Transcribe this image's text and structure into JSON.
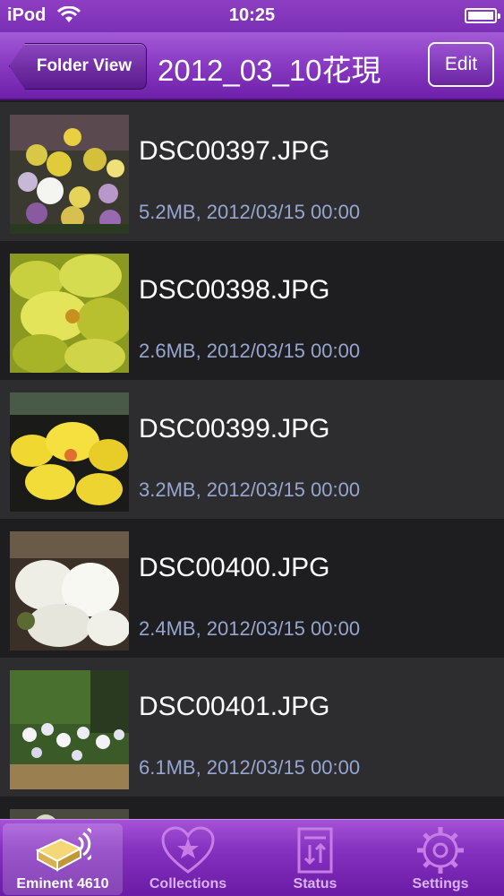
{
  "status_bar": {
    "carrier": "iPod",
    "time": "10:25"
  },
  "nav": {
    "back_label": "Folder View",
    "title": "2012_03_10花現",
    "edit_label": "Edit"
  },
  "files": [
    {
      "name": "DSC00397.JPG",
      "meta": "5.2MB, 2012/03/15 00:00"
    },
    {
      "name": "DSC00398.JPG",
      "meta": "2.6MB, 2012/03/15 00:00"
    },
    {
      "name": "DSC00399.JPG",
      "meta": "3.2MB, 2012/03/15 00:00"
    },
    {
      "name": "DSC00400.JPG",
      "meta": "2.4MB, 2012/03/15 00:00"
    },
    {
      "name": "DSC00401.JPG",
      "meta": "6.1MB, 2012/03/15 00:00"
    }
  ],
  "tabs": [
    {
      "label": "Eminent 4610",
      "icon": "drive-wireless-icon",
      "active": true
    },
    {
      "label": "Collections",
      "icon": "heart-star-icon",
      "active": false
    },
    {
      "label": "Status",
      "icon": "status-doc-icon",
      "active": false
    },
    {
      "label": "Settings",
      "icon": "gear-icon",
      "active": false
    }
  ],
  "colors": {
    "accent": "#8a3cc4",
    "meta_text": "#96a6d0"
  }
}
